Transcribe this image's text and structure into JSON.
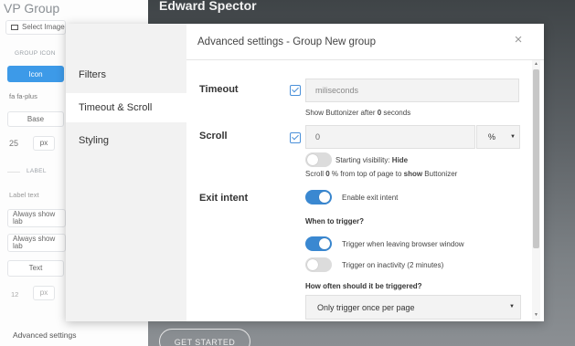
{
  "background_editor": {
    "title": "VP Group",
    "select_image": "Select Image",
    "group_icon_label": "GROUP ICON",
    "icon_button": "Icon",
    "icon_class": "fa fa-plus",
    "base_button": "Base",
    "size_value": "25",
    "size_unit": "px",
    "label_section": "LABEL",
    "label_placeholder": "Label text",
    "always_show_1": "Always show lab",
    "always_show_2": "Always show lab",
    "text_button": "Text",
    "font_size_value": "12",
    "font_size_unit": "px",
    "advanced_settings": "Advanced settings"
  },
  "background_preview": {
    "name": "Edward Spector",
    "cta": "GET STARTED"
  },
  "modal": {
    "title": "Advanced settings - Group New group",
    "close_glyph": "×",
    "tabs": [
      {
        "label": "Filters",
        "active": false
      },
      {
        "label": "Timeout & Scroll",
        "active": true
      },
      {
        "label": "Styling",
        "active": false
      }
    ],
    "timeout": {
      "label": "Timeout",
      "checked": true,
      "placeholder": "miliseconds",
      "note_pre": "Show Buttonizer after ",
      "note_value": "0",
      "note_post": " seconds"
    },
    "scroll": {
      "label": "Scroll",
      "checked": true,
      "value": "0",
      "unit": "%",
      "visibility_pre": "Starting visibility: ",
      "visibility_value": "Hide",
      "visibility_on": false,
      "note_pre": "Scroll ",
      "note_value": "0",
      "note_mid": " % from top of page to ",
      "note_action": "show",
      "note_post": " Buttonizer"
    },
    "exit_intent": {
      "label": "Exit intent",
      "enable_label": "Enable exit intent",
      "enabled": true,
      "when_heading": "When to trigger?",
      "trigger_leave_label": "Trigger when leaving browser window",
      "trigger_leave_on": true,
      "trigger_inactivity_label": "Trigger on inactivity (2 minutes)",
      "trigger_inactivity_on": false,
      "how_often_heading": "How often should it be triggered?",
      "frequency_value": "Only trigger once per page"
    }
  },
  "colors": {
    "accent": "#3a88d1",
    "checkbox": "#4a90d9",
    "sidebar": "#f2f2f2"
  }
}
